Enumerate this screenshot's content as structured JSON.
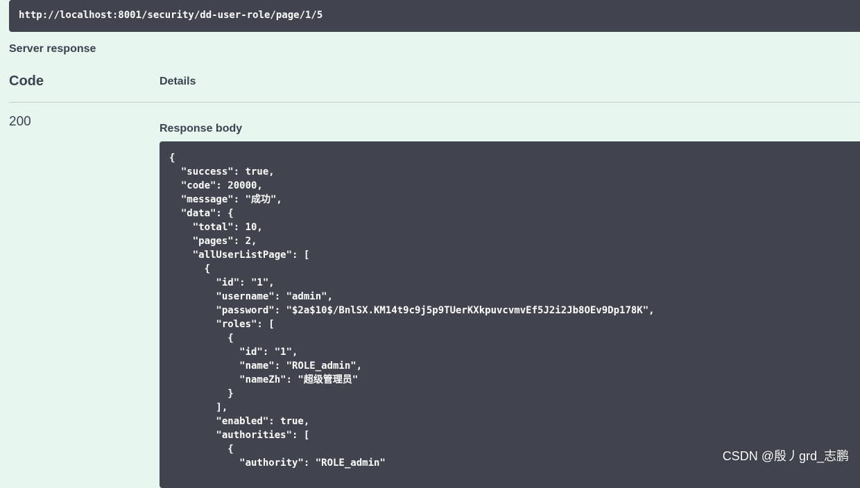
{
  "request_url": "http://localhost:8001/security/dd-user-role/page/1/5",
  "server_response_label": "Server response",
  "columns": {
    "code": "Code",
    "details": "Details"
  },
  "status_code": "200",
  "response_body_label": "Response body",
  "response_body": "{\n  \"success\": true,\n  \"code\": 20000,\n  \"message\": \"成功\",\n  \"data\": {\n    \"total\": 10,\n    \"pages\": 2,\n    \"allUserListPage\": [\n      {\n        \"id\": \"1\",\n        \"username\": \"admin\",\n        \"password\": \"$2a$10$/BnlSX.KM14t9c9j5p9TUerKXkpuvcvmvEf5J2i2Jb8OEv9Dp178K\",\n        \"roles\": [\n          {\n            \"id\": \"1\",\n            \"name\": \"ROLE_admin\",\n            \"nameZh\": \"超级管理员\"\n          }\n        ],\n        \"enabled\": true,\n        \"authorities\": [\n          {\n            \"authority\": \"ROLE_admin\"",
  "watermark": "CSDN @殷丿grd_志鹏",
  "colors": {
    "background": "#e8f6f0",
    "code_block": "#41444e",
    "text": "#3b4151"
  }
}
